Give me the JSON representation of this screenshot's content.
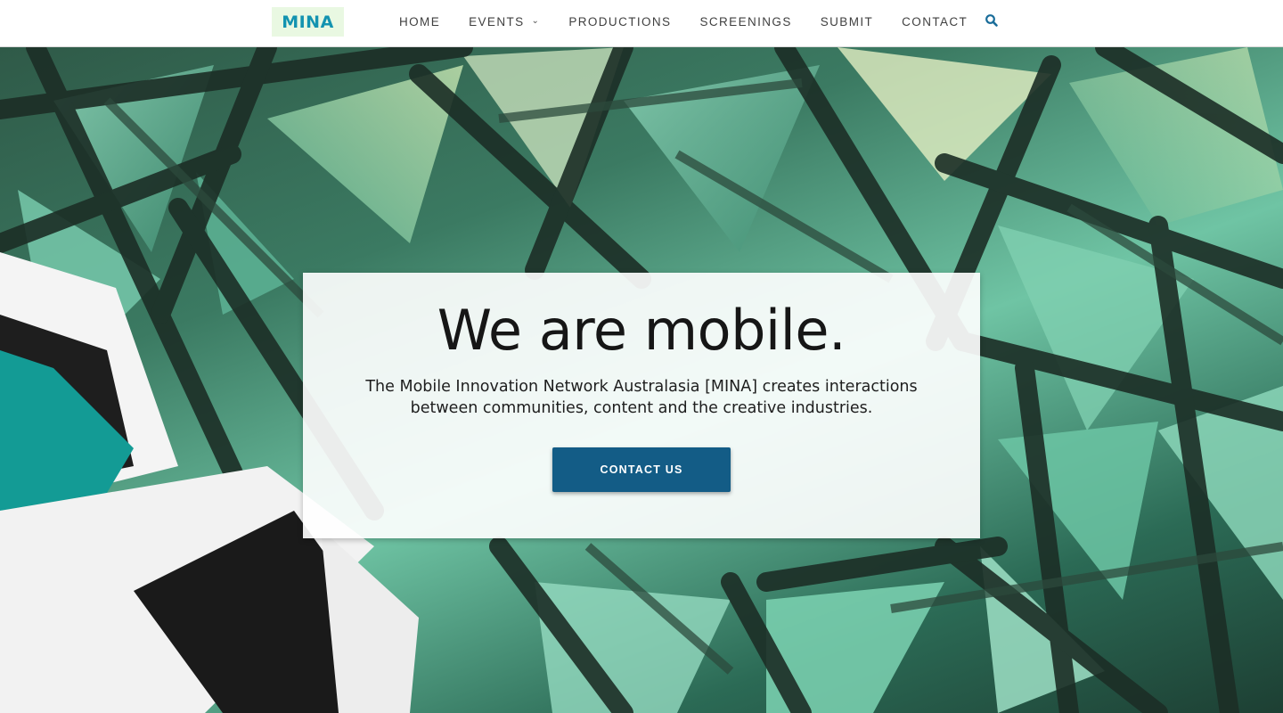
{
  "header": {
    "logo_text": "MINA",
    "nav": [
      {
        "label": "HOME"
      },
      {
        "label": "EVENTS",
        "has_dropdown": true
      },
      {
        "label": "PRODUCTIONS"
      },
      {
        "label": "SCREENINGS"
      },
      {
        "label": "SUBMIT"
      },
      {
        "label": "CONTACT"
      }
    ],
    "search_icon": "search-icon"
  },
  "hero": {
    "heading": "We are mobile.",
    "description": "The Mobile Innovation Network Australasia [MINA] creates interactions between communities, content and the creative industries.",
    "cta_label": "CONTACT US"
  },
  "colors": {
    "logo_bg": "#e9f8e2",
    "logo_text": "#1393b0",
    "accent": "#135c86",
    "search_icon": "#1a6d9a"
  }
}
